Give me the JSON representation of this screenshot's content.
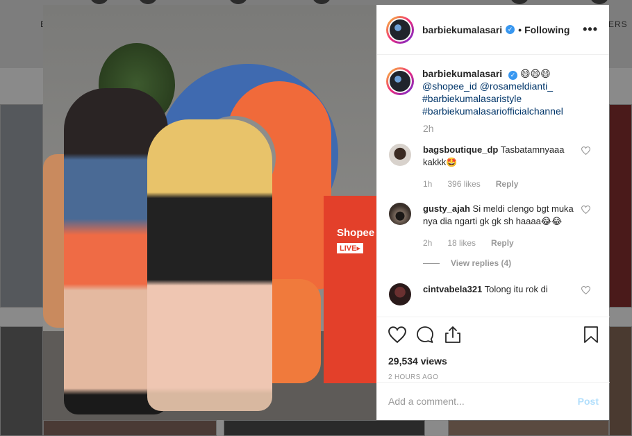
{
  "background": {
    "tab_left": "E",
    "tab_right": "ERS"
  },
  "post": {
    "username": "barbiekumalasari",
    "verified_mark": "✓",
    "separator": "•",
    "follow_status": "Following",
    "more_label": "•••",
    "media_text": {
      "brand": "Shopee",
      "live": "LIVE▸"
    }
  },
  "caption": {
    "username": "barbiekumalasari",
    "emojis": "😄😄😄",
    "mentions": "@shopee_id @rosameldianti_",
    "hashtag1": "#barbiekumalasaristyle",
    "hashtag2": "#barbiekumalasariofficialchannel",
    "time": "2h"
  },
  "comments": [
    {
      "username": "bagsboutique_dp",
      "text": "Tasbatamnyaaa kakkk🤩",
      "time": "1h",
      "likes": "396 likes",
      "reply": "Reply"
    },
    {
      "username": "gusty_ajah",
      "text": "Si meldi clengo bgt muka nya dia ngarti gk gk sh haaaa😂😂",
      "time": "2h",
      "likes": "18 likes",
      "reply": "Reply",
      "view_replies": "View replies (4)"
    },
    {
      "username": "cintvabela321",
      "text": "Tolong itu rok di"
    }
  ],
  "stats": {
    "views": "29,534 views",
    "time_ago": "2 HOURS AGO"
  },
  "add_comment": {
    "placeholder": "Add a comment...",
    "post_label": "Post"
  },
  "colors": {
    "accent_link": "#003569",
    "verified": "#3897f0",
    "post_button_disabled": "#b2dffc"
  }
}
